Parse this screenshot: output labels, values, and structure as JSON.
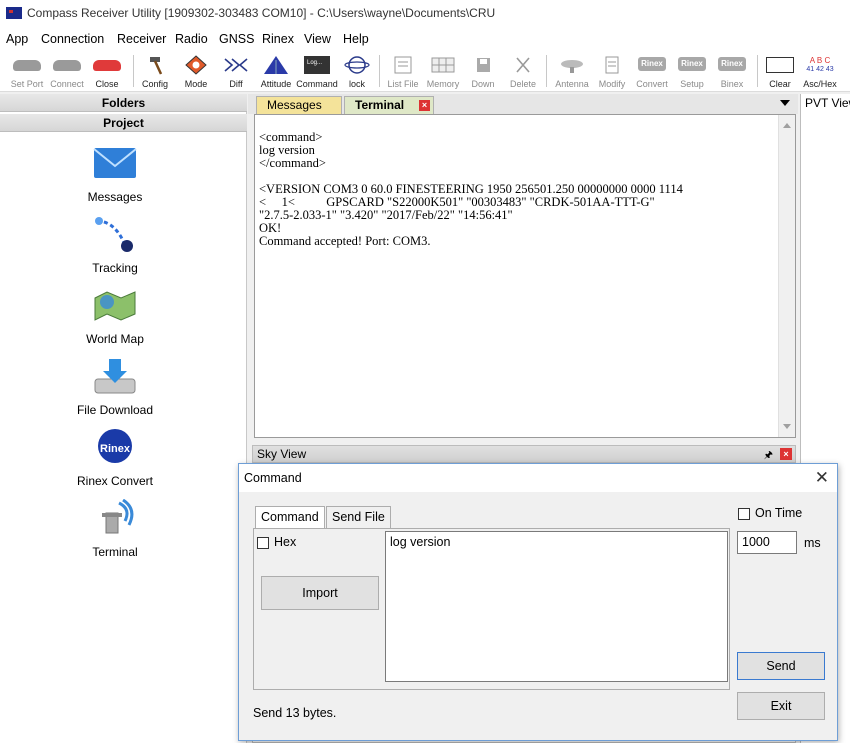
{
  "window": {
    "title": "Compass Receiver Utility [1909302-303483 COM10] - C:\\Users\\wayne\\Documents\\CRU"
  },
  "menu": [
    "App",
    "Connection",
    "Receiver",
    "Radio",
    "GNSS",
    "Rinex",
    "View",
    "Help"
  ],
  "toolbar": [
    {
      "label": "Set Port",
      "enabled": false
    },
    {
      "label": "Connect",
      "enabled": false
    },
    {
      "label": "Close",
      "enabled": true
    },
    {
      "label": "Config",
      "enabled": true
    },
    {
      "label": "Mode",
      "enabled": true
    },
    {
      "label": "Diff",
      "enabled": true
    },
    {
      "label": "Attitude",
      "enabled": true
    },
    {
      "label": "Command",
      "enabled": true
    },
    {
      "label": "lock",
      "enabled": true
    },
    {
      "label": "List File",
      "enabled": false
    },
    {
      "label": "Memory",
      "enabled": false
    },
    {
      "label": "Down",
      "enabled": false
    },
    {
      "label": "Delete",
      "enabled": false
    },
    {
      "label": "Antenna",
      "enabled": false
    },
    {
      "label": "Modify",
      "enabled": false
    },
    {
      "label": "Convert",
      "enabled": false
    },
    {
      "label": "Setup",
      "enabled": false
    },
    {
      "label": "Binex",
      "enabled": false
    },
    {
      "label": "Clear",
      "enabled": true
    },
    {
      "label": "Asc/Hex",
      "enabled": true
    }
  ],
  "toolbar_icon_text": {
    "command_screen": "Log...",
    "rinex": "Rinex",
    "abc": "A B C",
    "hex": "41 42 43"
  },
  "left_panel": {
    "folders": "Folders",
    "project": "Project",
    "items": [
      {
        "label": "Messages",
        "icon": "envelope-icon"
      },
      {
        "label": "Tracking",
        "icon": "satellite-tracking-icon"
      },
      {
        "label": "World Map",
        "icon": "world-map-icon"
      },
      {
        "label": "File Download",
        "icon": "download-icon"
      },
      {
        "label": "Rinex Convert",
        "icon": "rinex-convert-icon"
      },
      {
        "label": "Terminal",
        "icon": "terminal-antenna-icon"
      }
    ]
  },
  "rinex_icon_text": "Rinex",
  "doc_tabs": [
    {
      "label": "Messages",
      "active": false
    },
    {
      "label": "Terminal",
      "active": true
    }
  ],
  "pvt_tab": "PVT View",
  "terminal": {
    "text": "<command>\nlog version\n</command>\n\n<VERSION COM3 0 60.0 FINESTEERING 1950 256501.250 00000000 0000 1114\n<     1<          GPSCARD \"S22000K501\" \"00303483\" \"CRDK-501AA-TTT-G\"\n\"2.7.5-2.033-1\" \"3.420\" \"2017/Feb/22\" \"14:56:41\"\nOK!\nCommand accepted! Port: COM3."
  },
  "sky_view": {
    "title": "Sky View"
  },
  "dialog": {
    "title": "Command",
    "tabs": [
      "Command",
      "Send File"
    ],
    "hex_label": "Hex",
    "import_label": "Import",
    "command_text": "log version",
    "on_time_label": "On Time",
    "interval_value": "1000",
    "interval_unit": "ms",
    "send_label": "Send",
    "exit_label": "Exit",
    "status": "Send 13 bytes."
  }
}
